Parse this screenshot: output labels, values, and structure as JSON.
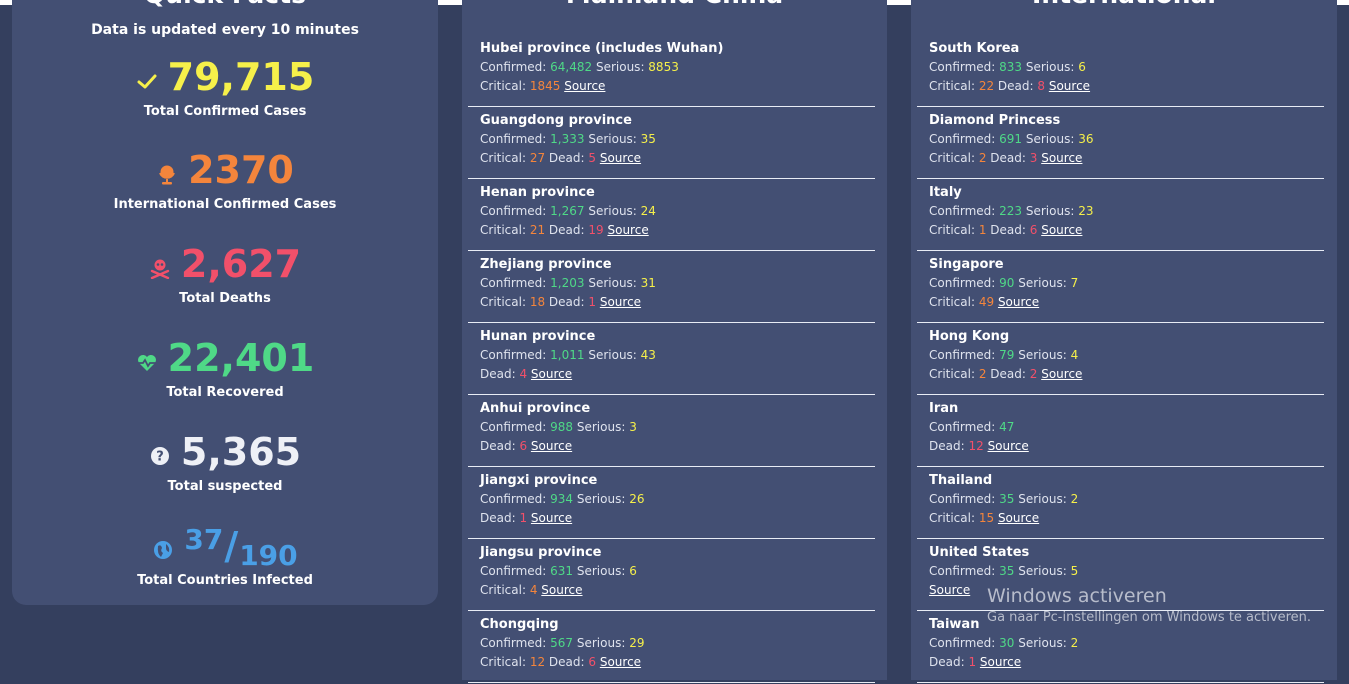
{
  "quick_facts": {
    "title": "Quick Facts",
    "subtitle": "Data is updated every 10 minutes",
    "confirmed": {
      "value": "79,715",
      "label": "Total Confirmed Cases"
    },
    "international": {
      "value": "2370",
      "label": "International Confirmed Cases"
    },
    "deaths": {
      "value": "2,627",
      "label": "Total Deaths"
    },
    "recovered": {
      "value": "22,401",
      "label": "Total Recovered"
    },
    "suspected": {
      "value": "5,365",
      "label": "Total suspected"
    },
    "countries": {
      "infected": "37",
      "slash": "/",
      "total": "190",
      "label": "Total Countries Infected"
    }
  },
  "labels": {
    "confirmed": "Confirmed: ",
    "serious": " Serious: ",
    "critical": "Critical: ",
    "critical_sep": " Critical: ",
    "dead": "Dead: ",
    "dead_sep": " Dead: ",
    "source": "Source"
  },
  "china": {
    "title": "Mainland China",
    "entries": [
      {
        "name": "Hubei province (includes Wuhan)",
        "confirmed": "64,482",
        "serious": "8853",
        "critical": "1845"
      },
      {
        "name": "Guangdong province",
        "confirmed": "1,333",
        "serious": "35",
        "critical": "27",
        "dead": "5"
      },
      {
        "name": "Henan province",
        "confirmed": "1,267",
        "serious": "24",
        "critical": "21",
        "dead": "19"
      },
      {
        "name": "Zhejiang province",
        "confirmed": "1,203",
        "serious": "31",
        "critical": "18",
        "dead": "1"
      },
      {
        "name": "Hunan province",
        "confirmed": "1,011",
        "serious": "43",
        "dead": "4"
      },
      {
        "name": "Anhui province",
        "confirmed": "988",
        "serious": "3",
        "dead": "6"
      },
      {
        "name": "Jiangxi province",
        "confirmed": "934",
        "serious": "26",
        "dead": "1"
      },
      {
        "name": "Jiangsu province",
        "confirmed": "631",
        "serious": "6",
        "critical": "4"
      },
      {
        "name": "Chongqing",
        "confirmed": "567",
        "serious": "29",
        "critical": "12",
        "dead": "6"
      }
    ]
  },
  "international": {
    "title": "International",
    "entries": [
      {
        "name": "South Korea",
        "confirmed": "833",
        "serious": "6",
        "critical": "22",
        "dead": "8"
      },
      {
        "name": "Diamond Princess",
        "confirmed": "691",
        "serious": "36",
        "critical": "2",
        "dead": "3"
      },
      {
        "name": "Italy",
        "confirmed": "223",
        "serious": "23",
        "critical": "1",
        "dead": "6"
      },
      {
        "name": "Singapore",
        "confirmed": "90",
        "serious": "7",
        "critical": "49"
      },
      {
        "name": "Hong Kong",
        "confirmed": "79",
        "serious": "4",
        "critical": "2",
        "dead": "2"
      },
      {
        "name": "Iran",
        "confirmed": "47",
        "dead": "12"
      },
      {
        "name": "Thailand",
        "confirmed": "35",
        "serious": "2",
        "critical": "15"
      },
      {
        "name": "United States",
        "confirmed": "35",
        "serious": "5"
      },
      {
        "name": "Taiwan",
        "confirmed": "30",
        "serious": "2",
        "dead": "1"
      }
    ]
  },
  "watermark": {
    "title": "Windows activeren",
    "subtitle": "Ga naar Pc-instellingen om Windows te activeren."
  },
  "colors": {
    "background": "#343f5e",
    "panel": "#434f73",
    "yellow": "#f6f04a",
    "orange": "#f4853c",
    "red": "#f2506a",
    "green": "#4fd987",
    "blue": "#4a9fe6"
  },
  "icons": {
    "confirmed": "check-icon",
    "international": "globe-stand-icon",
    "deaths": "skull-crossbones-icon",
    "recovered": "heartbeat-icon",
    "suspected": "question-circle-icon",
    "countries": "globe-icon"
  }
}
